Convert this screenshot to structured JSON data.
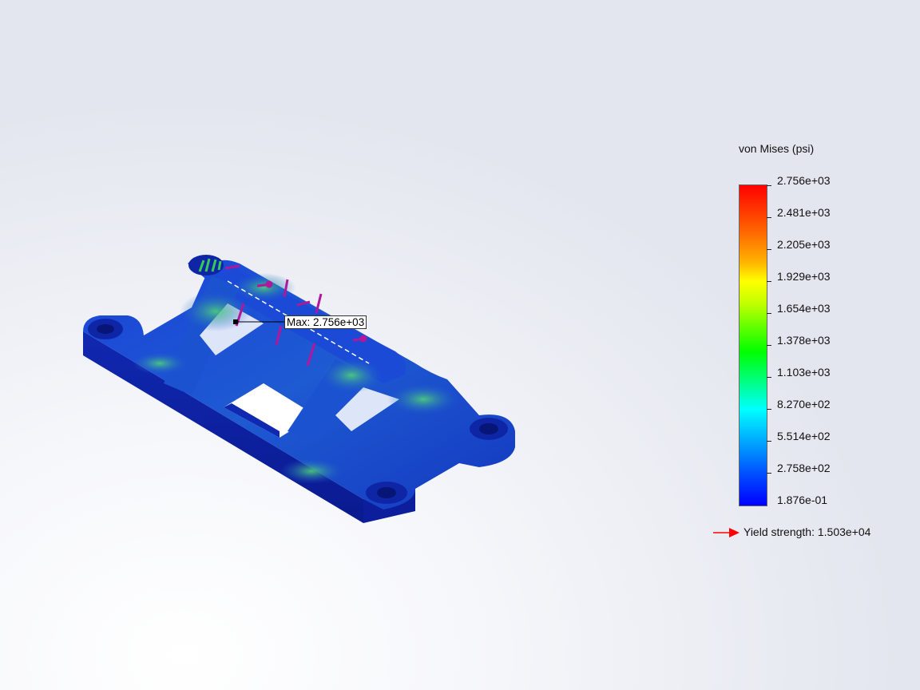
{
  "legend": {
    "title": "von Mises (psi)",
    "ticks": [
      "2.756e+03",
      "2.481e+03",
      "2.205e+03",
      "1.929e+03",
      "1.654e+03",
      "1.378e+03",
      "1.103e+03",
      "8.270e+02",
      "5.514e+02",
      "2.758e+02",
      "1.876e-01"
    ],
    "yield_label": "Yield strength: 1.503e+04",
    "yield_color": "#ff0000"
  },
  "annotation": {
    "max_label": "Max: 2.756e+03"
  },
  "colors": {
    "part_base": "#1530c8",
    "load_arrows": "#b0189c",
    "highlight": "#39c957"
  },
  "icons": [
    "load-arrow-icon",
    "fixture-icon",
    "yield-arrow-icon"
  ]
}
